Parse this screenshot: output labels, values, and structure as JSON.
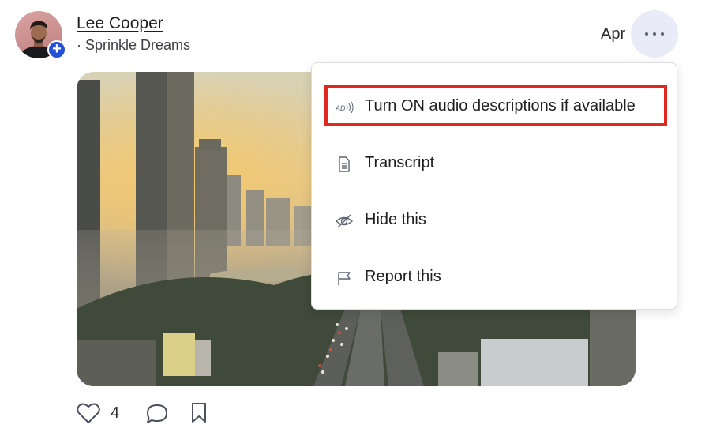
{
  "post": {
    "author": "Lee Cooper",
    "community": "· Sprinkle Dreams",
    "date": "Apr"
  },
  "menu": {
    "items": [
      {
        "label": "Turn ON audio descriptions if available",
        "icon": "audio-description-icon"
      },
      {
        "label": "Transcript",
        "icon": "document-icon"
      },
      {
        "label": "Hide this",
        "icon": "eye-off-icon"
      },
      {
        "label": "Report this",
        "icon": "flag-icon"
      }
    ],
    "highlighted_index": 0,
    "highlight_color": "#e0281f"
  },
  "footer": {
    "like_count": "4"
  },
  "colors": {
    "accent": "#2450d8",
    "more_button_bg": "#e9ebf8",
    "icon_gray": "#5b6270"
  }
}
